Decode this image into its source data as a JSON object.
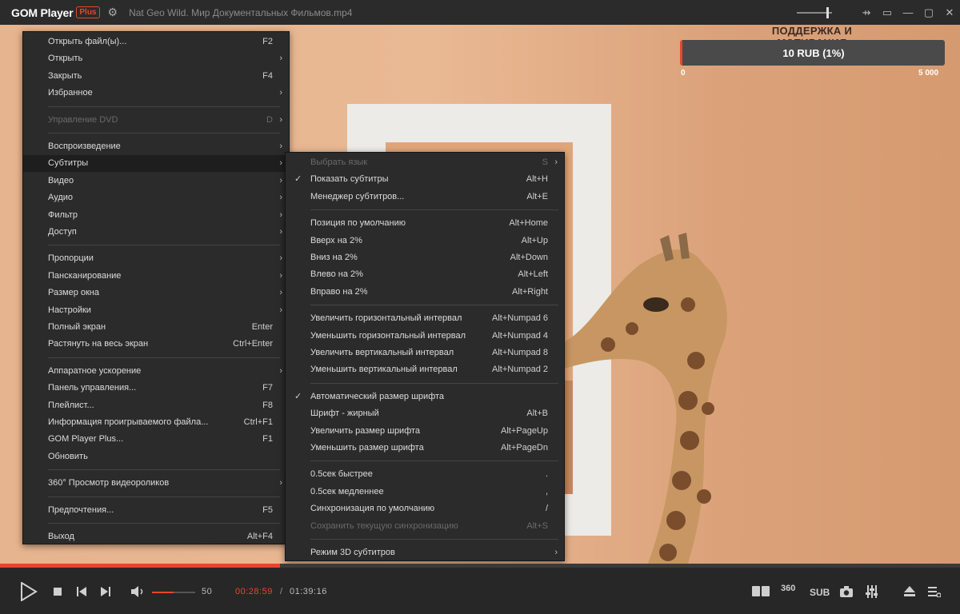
{
  "titlebar": {
    "app_name": "GOM Player",
    "badge": "Plus",
    "filename": "Nat Geo Wild. Мир Документальных Фильмов.mp4",
    "buttons": [
      "⇸",
      "▭",
      "—",
      "▢",
      "✕"
    ]
  },
  "support": {
    "title": "ПОДДЕРЖКА И МОТИВАЦИЯ",
    "amount": "10 RUB (1%)",
    "min": "0",
    "max": "5 000",
    "progress_percent": 1
  },
  "menu": [
    {
      "type": "item",
      "label": "Открыть файл(ы)...",
      "shortcut": "F2"
    },
    {
      "type": "item",
      "label": "Открыть",
      "submenu": true
    },
    {
      "type": "item",
      "label": "Закрыть",
      "shortcut": "F4"
    },
    {
      "type": "item",
      "label": "Избранное",
      "submenu": true
    },
    {
      "type": "sep"
    },
    {
      "type": "item",
      "label": "Управление DVD",
      "shortcut": "D",
      "submenu": true,
      "disabled": true
    },
    {
      "type": "sep"
    },
    {
      "type": "item",
      "label": "Воспроизведение",
      "submenu": true
    },
    {
      "type": "item",
      "label": "Субтитры",
      "submenu": true,
      "selected": true
    },
    {
      "type": "item",
      "label": "Видео",
      "submenu": true
    },
    {
      "type": "item",
      "label": "Аудио",
      "submenu": true
    },
    {
      "type": "item",
      "label": "Фильтр",
      "submenu": true
    },
    {
      "type": "item",
      "label": "Доступ",
      "submenu": true
    },
    {
      "type": "sep"
    },
    {
      "type": "item",
      "label": "Пропорции",
      "submenu": true
    },
    {
      "type": "item",
      "label": "Пансканирование",
      "submenu": true
    },
    {
      "type": "item",
      "label": "Размер окна",
      "submenu": true
    },
    {
      "type": "item",
      "label": "Настройки",
      "submenu": true
    },
    {
      "type": "item",
      "label": "Полный экран",
      "shortcut": "Enter"
    },
    {
      "type": "item",
      "label": "Растянуть на весь экран",
      "shortcut": "Ctrl+Enter"
    },
    {
      "type": "sep"
    },
    {
      "type": "item",
      "label": "Аппаратное ускорение",
      "submenu": true
    },
    {
      "type": "item",
      "label": "Панель управления...",
      "shortcut": "F7"
    },
    {
      "type": "item",
      "label": "Плейлист...",
      "shortcut": "F8"
    },
    {
      "type": "item",
      "label": "Информация проигрываемого файла...",
      "shortcut": "Ctrl+F1"
    },
    {
      "type": "item",
      "label": "GOM Player Plus...",
      "shortcut": "F1"
    },
    {
      "type": "item",
      "label": "Обновить"
    },
    {
      "type": "sep"
    },
    {
      "type": "item",
      "label": "360° Просмотр видеороликов",
      "submenu": true
    },
    {
      "type": "sep"
    },
    {
      "type": "item",
      "label": "Предпочтения...",
      "shortcut": "F5"
    },
    {
      "type": "sep"
    },
    {
      "type": "item",
      "label": "Выход",
      "shortcut": "Alt+F4"
    }
  ],
  "submenu": [
    {
      "type": "item",
      "label": "Выбрать язык",
      "shortcut": "S",
      "submenu": true,
      "disabled": true
    },
    {
      "type": "item",
      "label": "Показать субтитры",
      "shortcut": "Alt+H",
      "checked": true
    },
    {
      "type": "item",
      "label": "Менеджер субтитров...",
      "shortcut": "Alt+E"
    },
    {
      "type": "sep"
    },
    {
      "type": "item",
      "label": "Позиция по умолчанию",
      "shortcut": "Alt+Home"
    },
    {
      "type": "item",
      "label": "Вверх на 2%",
      "shortcut": "Alt+Up"
    },
    {
      "type": "item",
      "label": "Вниз на 2%",
      "shortcut": "Alt+Down"
    },
    {
      "type": "item",
      "label": "Влево на 2%",
      "shortcut": "Alt+Left"
    },
    {
      "type": "item",
      "label": "Вправо на 2%",
      "shortcut": "Alt+Right"
    },
    {
      "type": "sep"
    },
    {
      "type": "item",
      "label": "Увеличить горизонтальный интервал",
      "shortcut": "Alt+Numpad 6"
    },
    {
      "type": "item",
      "label": "Уменьшить горизонтальный интервал",
      "shortcut": "Alt+Numpad 4"
    },
    {
      "type": "item",
      "label": "Увеличить вертикальный интервал",
      "shortcut": "Alt+Numpad 8"
    },
    {
      "type": "item",
      "label": "Уменьшить вертикальный интервал",
      "shortcut": "Alt+Numpad 2"
    },
    {
      "type": "sep"
    },
    {
      "type": "item",
      "label": "Автоматический размер шрифта",
      "checked": true
    },
    {
      "type": "item",
      "label": "Шрифт - жирный",
      "shortcut": "Alt+B"
    },
    {
      "type": "item",
      "label": "Увеличить размер шрифта",
      "shortcut": "Alt+PageUp"
    },
    {
      "type": "item",
      "label": "Уменьшить размер шрифта",
      "shortcut": "Alt+PageDn"
    },
    {
      "type": "sep"
    },
    {
      "type": "item",
      "label": "0.5сек быстрее",
      "shortcut": "."
    },
    {
      "type": "item",
      "label": "0.5сек медленнее",
      "shortcut": ","
    },
    {
      "type": "item",
      "label": "Синхронизация по умолчанию",
      "shortcut": "/"
    },
    {
      "type": "item",
      "label": "Сохранить текущую синхронизацию",
      "shortcut": "Alt+S",
      "disabled": true
    },
    {
      "type": "sep"
    },
    {
      "type": "item",
      "label": "Режим 3D субтитров",
      "submenu": true
    }
  ],
  "controls": {
    "volume": "50",
    "volume_percent": 50,
    "time_current": "00:28:59",
    "time_separator": "/",
    "time_total": "01:39:16",
    "playback_percent": 29.2,
    "label_360": "360",
    "label_sub": "SUB"
  },
  "colors": {
    "accent": "#e8452a"
  }
}
